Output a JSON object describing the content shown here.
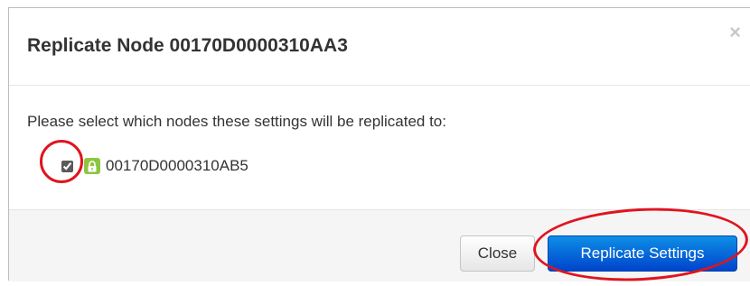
{
  "dialog": {
    "title": "Replicate Node 00170D0000310AA3",
    "close_symbol": "×"
  },
  "body": {
    "prompt": "Please select which nodes these settings will be replicated to:",
    "nodes": [
      {
        "label": "00170D0000310AB5",
        "checked": true,
        "icon": "lock-icon"
      }
    ]
  },
  "footer": {
    "close_label": "Close",
    "replicate_label": "Replicate Settings"
  },
  "colors": {
    "primary_button": "#0055cc",
    "lock_badge": "#8cc63f",
    "annotation": "#e0141e"
  }
}
